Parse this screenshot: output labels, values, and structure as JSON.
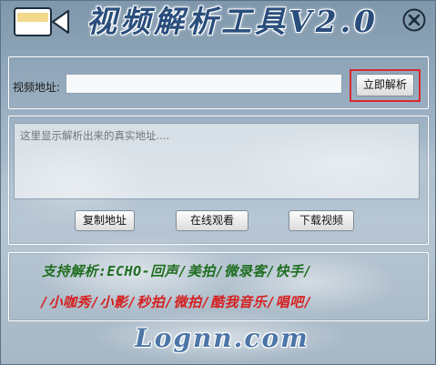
{
  "window": {
    "title": "视频解析工具V2.0",
    "app_icon": "video-camera-icon",
    "close_icon": "close-x-icon"
  },
  "url_section": {
    "label": "视频地址:",
    "input_value": "",
    "parse_button": "立即解析"
  },
  "result": {
    "placeholder": "这里显示解析出来的真实地址....",
    "buttons": {
      "copy": "复制地址",
      "watch": "在线观看",
      "download": "下载视频"
    }
  },
  "support": {
    "prefix": "支持解析:",
    "line1_sites": "ECHO-回声/美拍/微录客/快手/",
    "line2_sites": "/小咖秀/小影/秒拍/微拍/酷我音乐/唱吧/"
  },
  "footer": {
    "site": "Lognn.com"
  },
  "colors": {
    "accent_red": "#d61f1f",
    "support_green": "#1f6e20",
    "title_blue": "#2a4e7c",
    "logo_blue": "#4d76a8"
  }
}
